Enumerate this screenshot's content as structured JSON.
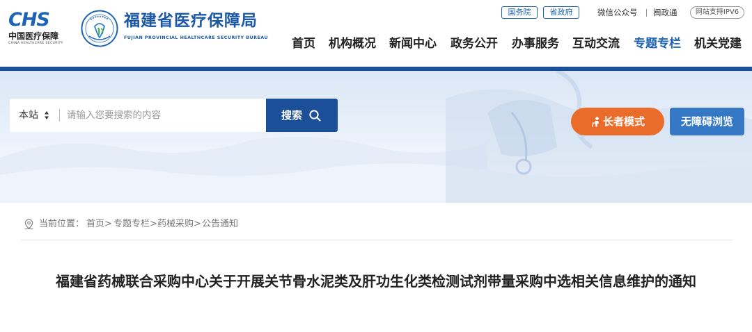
{
  "brand": {
    "logo_letters": "CHS",
    "logo_cn": "中国医疗保障",
    "logo_en": "CHINA HEALTHCARE SECURITY",
    "bureau_cn": "福建省医疗保障局",
    "bureau_en": "FUJIAN PROVINCIAL HEALTHCARE SECURITY BUREAU",
    "accent_color": "#1d63b6"
  },
  "top_links": {
    "state_council": "国务院",
    "provincial_gov": "省政府",
    "wechat": "微信公众号",
    "minzhengtong": "闽政通",
    "ipv6": "网站支持IPV6"
  },
  "nav": {
    "items": [
      "首页",
      "机构概况",
      "新闻中心",
      "政务公开",
      "办事服务",
      "互动交流",
      "专题专栏",
      "机关党建"
    ],
    "active_index": 6
  },
  "search": {
    "scope": "本站",
    "placeholder": "请输入您要搜索的内容",
    "button_label": "搜索"
  },
  "modes": {
    "elder": "长者模式",
    "accessible": "无障碍浏览"
  },
  "breadcrumb": {
    "label": "当前位置：",
    "items": [
      "首页>",
      "专题专栏>",
      "药械采购>"
    ],
    "current": "公告通知"
  },
  "article": {
    "title": "福建省药械联合采购中心关于开展关节骨水泥类及肝功生化类检测试剂带量采购中选相关信息维护的通知"
  },
  "icons": {
    "search": "search-icon",
    "location": "location-pin-icon",
    "elder": "elder-person-icon",
    "scope_arrows": "sort-arrows-icon"
  }
}
